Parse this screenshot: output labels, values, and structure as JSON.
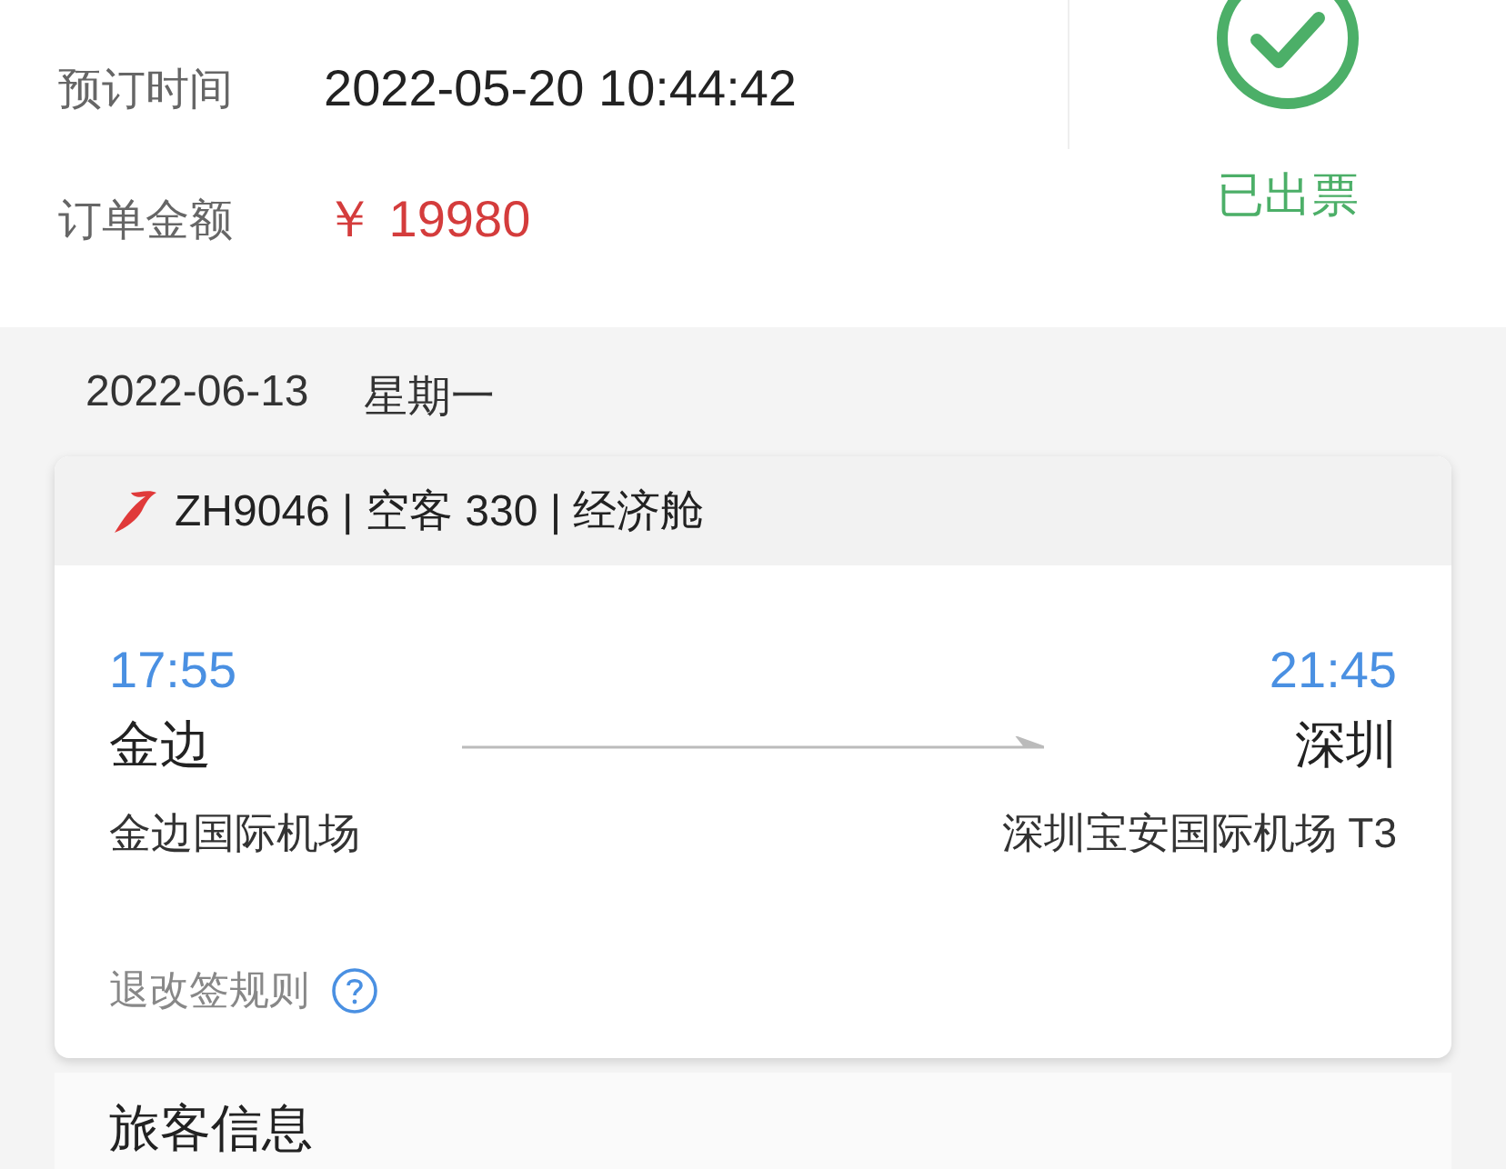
{
  "order_info": [
    {
      "label": "预订时间",
      "value": "2022-05-20 10:44:42",
      "kind": "plain"
    },
    {
      "label": "订单金额",
      "value": "￥ 19980",
      "kind": "price"
    }
  ],
  "status": {
    "label": "已出票"
  },
  "flight_date": {
    "date": "2022-06-13",
    "weekday": "星期一"
  },
  "flight": {
    "title": "ZH9046 | 空客 330 | 经济舱",
    "departure": {
      "time": "17:55",
      "city": "金边",
      "airport": "金边国际机场"
    },
    "arrival": {
      "time": "21:45",
      "city": "深圳",
      "airport": "深圳宝安国际机场 T3"
    },
    "rules_link": "退改签规则"
  },
  "passengers": {
    "title": "旅客信息"
  }
}
